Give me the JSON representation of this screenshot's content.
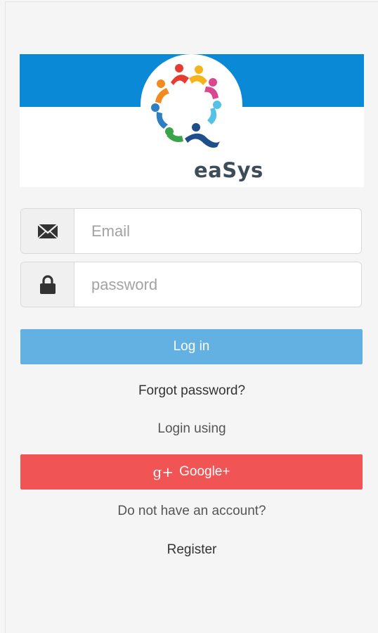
{
  "brand": {
    "name": "eaSys"
  },
  "colors": {
    "header_band": "#0a8ad6",
    "login_button": "#62b1e2",
    "google_button": "#f05455"
  },
  "form": {
    "email": {
      "placeholder": "Email",
      "value": "",
      "icon": "envelope-icon"
    },
    "password": {
      "placeholder": "password",
      "value": "",
      "icon": "lock-icon"
    }
  },
  "actions": {
    "login_label": "Log in",
    "forgot_label": "Forgot password?",
    "login_using_label": "Login using",
    "google_label": "Google+",
    "google_icon_glyph": "g+",
    "no_account_label": "Do not have an account?",
    "register_label": "Register"
  }
}
